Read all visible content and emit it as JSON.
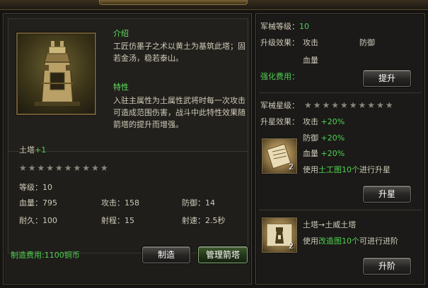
{
  "tower": {
    "intro_title": "介绍",
    "intro_text": "工匠仿墨子之术以黄土为基筑此塔；固若金汤，稳若泰山。",
    "trait_title": "特性",
    "trait_text": "入驻主属性为土属性武将时每一次攻击可造成范围伤害，战斗中此特性效果随箭塔的提升而增强。",
    "name": "土塔",
    "name_plus": "+1",
    "stars": "★★★★★★★★★★",
    "level_label": "等级：10",
    "stats": {
      "hp": "血量：795",
      "attack": "攻击：158",
      "defense": "防御：14",
      "durability": "耐久：100",
      "range": "射程：15",
      "speed": "射速：2.5秒"
    },
    "cost": "制造费用:1100铜币",
    "build_button": "制造",
    "manage_button": "管理箭塔"
  },
  "upgrade": {
    "level_label": "军械等级：",
    "level_value": "10",
    "effect_label": "升级效果：",
    "effect_attack": "攻击",
    "effect_defense": "防御",
    "effect_hp": "血量",
    "fee_label": "强化费用：",
    "upgrade_button": "提升"
  },
  "star": {
    "label": "军械星级：",
    "stars": "★★★★★★★★★★",
    "effect_label": "升星效果：",
    "attack": "攻击",
    "attack_val": "+20%",
    "defense": "防御",
    "defense_val": "+20%",
    "hp": "血量",
    "hp_val": "+20%",
    "item_count": "2",
    "use_prefix": "使用",
    "use_item": "土工图10个",
    "use_suffix": "进行升星",
    "button": "升星"
  },
  "advance": {
    "title": "土塔→土威土塔",
    "item_count": "2",
    "use_prefix": "使用",
    "use_item": "改造图10个",
    "use_suffix": "可进行进阶",
    "button": "升阶"
  },
  "colors": {
    "accent_green": "#4fd04f",
    "panel_border": "#4c4638",
    "gold_border": "#6d5a34"
  }
}
